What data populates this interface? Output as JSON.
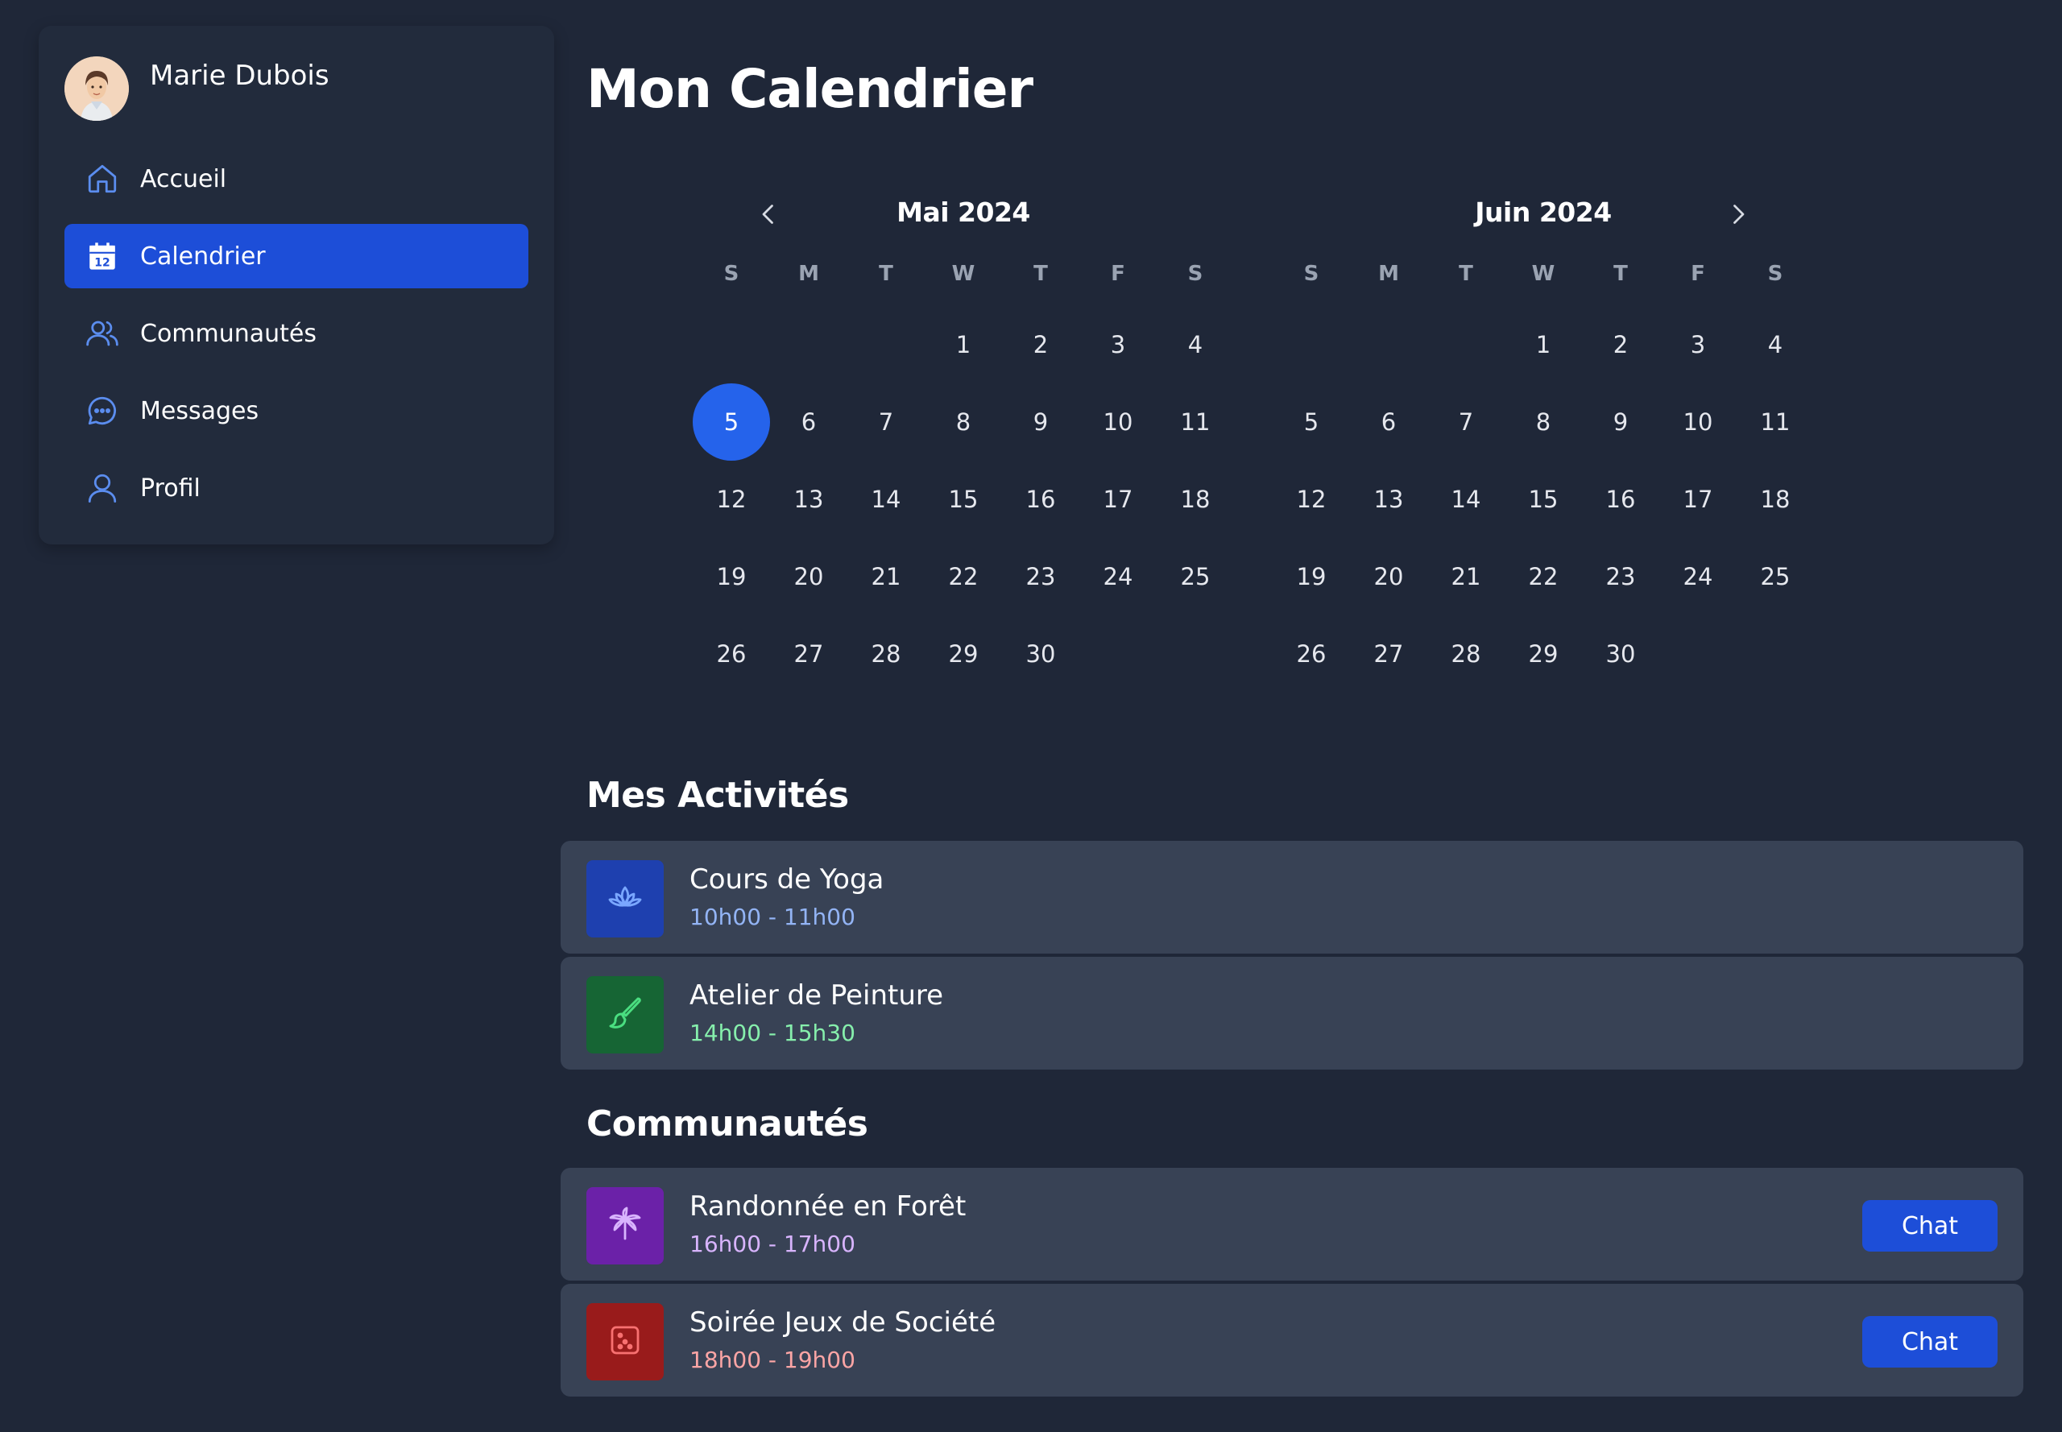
{
  "user": {
    "name": "Marie Dubois"
  },
  "nav": [
    {
      "label": "Accueil",
      "icon": "home-icon",
      "active": false
    },
    {
      "label": "Calendrier",
      "icon": "calendar-icon",
      "active": true
    },
    {
      "label": "Communautés",
      "icon": "users-icon",
      "active": false
    },
    {
      "label": "Messages",
      "icon": "message-icon",
      "active": false
    },
    {
      "label": "Profil",
      "icon": "user-icon",
      "active": false
    }
  ],
  "page": {
    "title": "Mon Calendrier"
  },
  "calendar": {
    "weekdays": [
      "S",
      "M",
      "T",
      "W",
      "T",
      "F",
      "S"
    ],
    "months": [
      {
        "title": "Mai 2024",
        "leading_blanks": 3,
        "days": 30,
        "selected": 5
      },
      {
        "title": "Juin 2024",
        "leading_blanks": 3,
        "days": 30,
        "selected": null
      }
    ]
  },
  "activities": {
    "title": "Mes Activités",
    "items": [
      {
        "title": "Cours de Yoga",
        "time": "10h00 - 11h00",
        "icon": "lotus-icon",
        "badge_color": "#1e40af",
        "time_color": "#93b4f5",
        "icon_color": "#7aa7ff"
      },
      {
        "title": "Atelier de Peinture",
        "time": "14h00 - 15h30",
        "icon": "paintbrush-icon",
        "badge_color": "#166534",
        "time_color": "#86efac",
        "icon_color": "#4ade80"
      }
    ]
  },
  "communities": {
    "title": "Communautés",
    "items": [
      {
        "title": "Randonnée en Forêt",
        "time": "16h00 - 17h00",
        "icon": "palm-tree-icon",
        "badge_color": "#6b21a8",
        "time_color": "#d8b4fe",
        "icon_color": "#d8b4fe",
        "action": "Chat"
      },
      {
        "title": "Soirée Jeux de Société",
        "time": "18h00 - 19h00",
        "icon": "dice-icon",
        "badge_color": "#991b1b",
        "time_color": "#fca5a5",
        "icon_color": "#f87171",
        "action": "Chat"
      }
    ]
  }
}
